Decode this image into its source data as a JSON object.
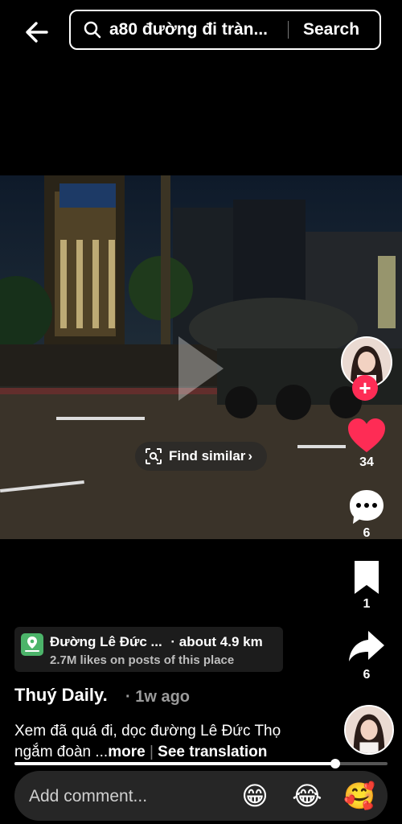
{
  "header": {
    "search_query": "a80 đường đi tràn...",
    "search_button": "Search"
  },
  "video": {
    "find_similar": "Find similar"
  },
  "rail": {
    "like_count": "34",
    "comment_count": "6",
    "save_count": "1",
    "share_count": "6"
  },
  "place": {
    "name": "Đường Lê Đức ...",
    "distance": "· about 4.9 km",
    "likes": "2.7M likes on posts of this place"
  },
  "post": {
    "author": "Thuý Daily.",
    "time": "· 1w ago",
    "caption_line1": "Xem đã quá đi, dọc đường Lê Đức Thọ",
    "caption_line2": "ngắm đoàn ...",
    "more": "more",
    "see_translation": "See translation"
  },
  "progress": {
    "fraction": 0.86
  },
  "comment_bar": {
    "placeholder": "Add comment...",
    "emojis": [
      "😁",
      "😂",
      "🥰"
    ]
  },
  "colors": {
    "like": "#fe2c55",
    "place_pin": "#4cb46a"
  }
}
